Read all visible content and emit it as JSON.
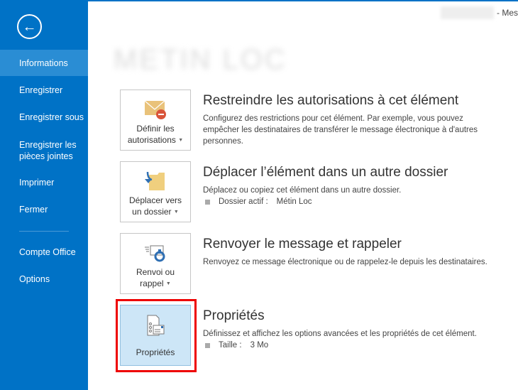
{
  "window_title": "- Mes",
  "sidebar": {
    "items": [
      {
        "label": "Informations",
        "selected": true
      },
      {
        "label": "Enregistrer"
      },
      {
        "label": "Enregistrer sous"
      },
      {
        "label": "Enregistrer les pièces jointes"
      },
      {
        "label": "Imprimer"
      },
      {
        "label": "Fermer"
      },
      {
        "label": "Compte Office"
      },
      {
        "label": "Options"
      }
    ]
  },
  "sections": [
    {
      "button_l1": "Définir les",
      "button_l2": "autorisations",
      "title": "Restreindre les autorisations à cet élément",
      "desc": "Configurez des restrictions pour cet élément. Par exemple, vous pouvez empêcher les destinataires de transférer le message électronique à d'autres personnes."
    },
    {
      "button_l1": "Déplacer vers",
      "button_l2": "un dossier",
      "title": "Déplacer l’élément dans un autre dossier",
      "desc": "Déplacez ou copiez cet élément dans un autre dossier.",
      "bullet_label": "Dossier actif :",
      "bullet_value": "Métin Loc"
    },
    {
      "button_l1": "Renvoi ou",
      "button_l2": "rappel",
      "title": "Renvoyer le message et rappeler",
      "desc": "Renvoyez ce message électronique ou de rappelez-le depuis les destinataires."
    },
    {
      "button_l1": "Propriétés",
      "title": "Propriétés",
      "desc": "Définissez et affichez les options avancées et les propriétés de cet élément.",
      "bullet_label": "Taille :",
      "bullet_value": "3 Mo"
    }
  ],
  "colors": {
    "sidebar": "#0072c6",
    "selected": "#2a8dd4",
    "highlight": "#ee0000"
  }
}
